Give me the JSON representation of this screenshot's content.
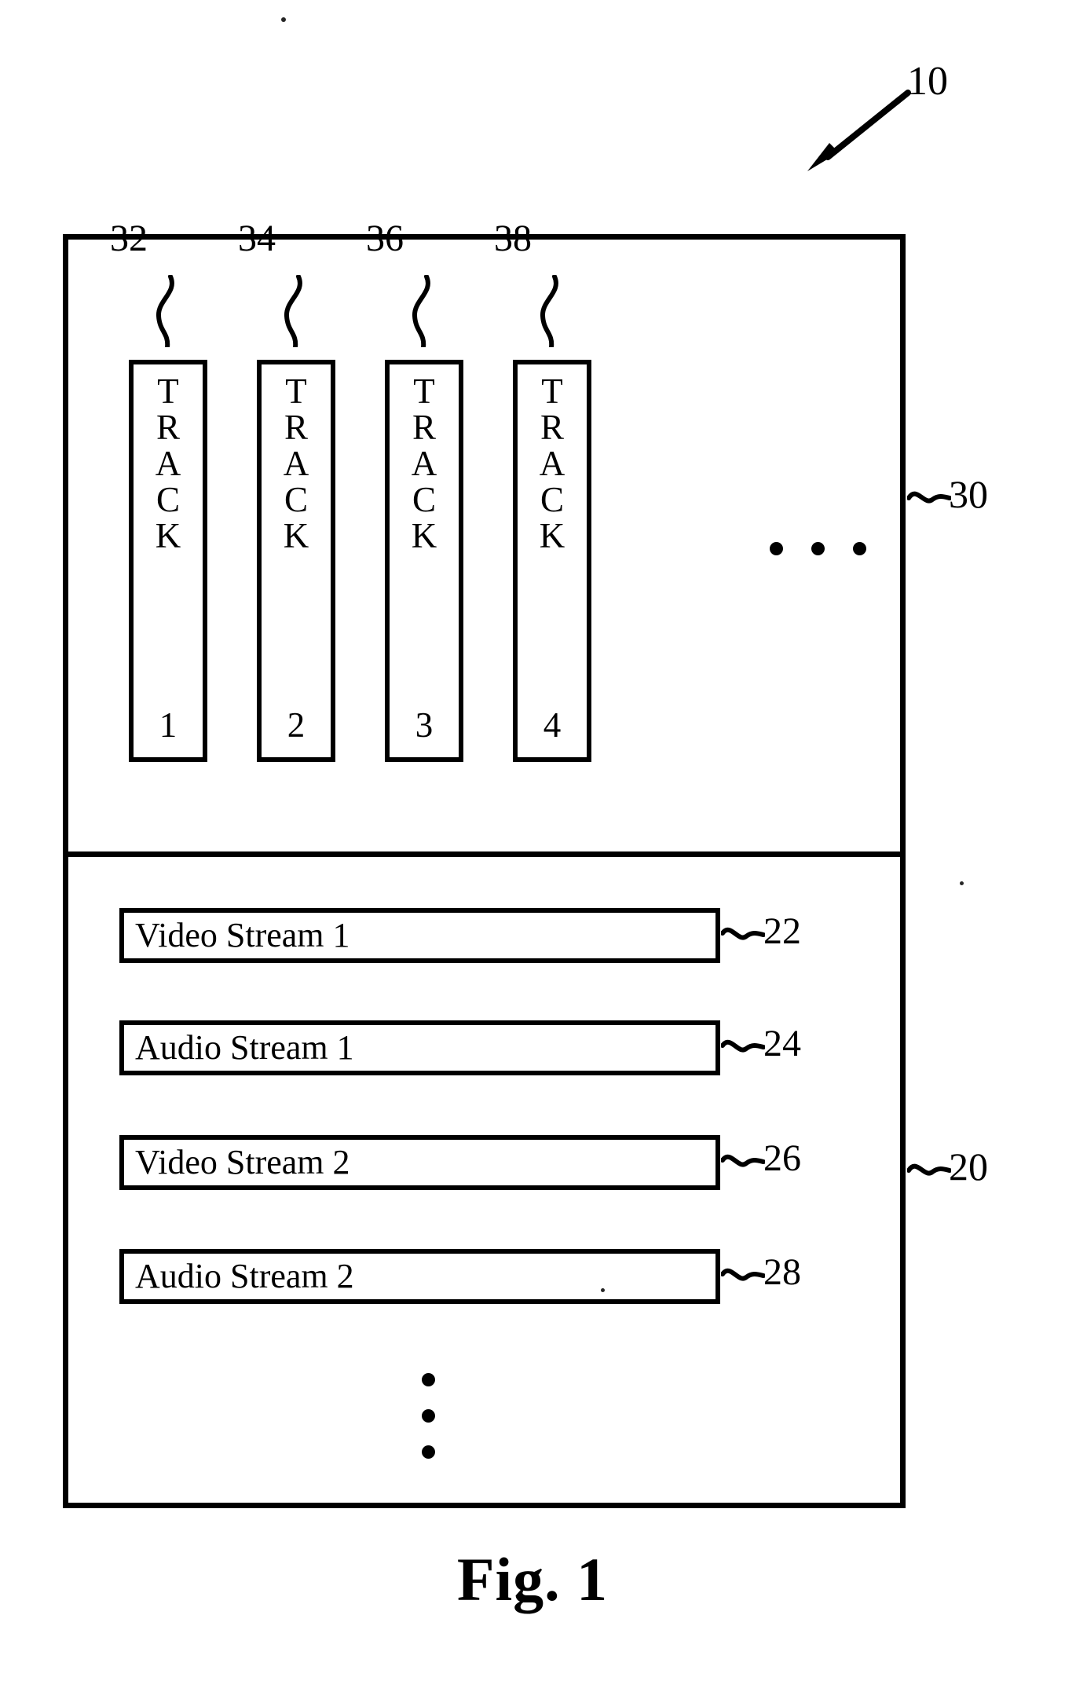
{
  "figure": {
    "caption": "Fig. 1",
    "overall_ref": "10"
  },
  "container": {
    "track_section": {
      "ref": "~30",
      "tracks": [
        {
          "ref": "32",
          "letters": [
            "T",
            "R",
            "A",
            "C",
            "K"
          ],
          "number": "1",
          "label": "TRACK 1"
        },
        {
          "ref": "34",
          "letters": [
            "T",
            "R",
            "A",
            "C",
            "K"
          ],
          "number": "2",
          "label": "TRACK 2"
        },
        {
          "ref": "36",
          "letters": [
            "T",
            "R",
            "A",
            "C",
            "K"
          ],
          "number": "3",
          "label": "TRACK 3"
        },
        {
          "ref": "38",
          "letters": [
            "T",
            "R",
            "A",
            "C",
            "K"
          ],
          "number": "4",
          "label": "TRACK 4"
        }
      ],
      "continuation": "• • •"
    },
    "stream_section": {
      "ref": "~20",
      "streams": [
        {
          "label": "Video Stream 1",
          "ref": "~22"
        },
        {
          "label": "Audio Stream 1",
          "ref": "~24"
        },
        {
          "label": "Video Stream 2",
          "ref": "~26"
        },
        {
          "label": "Audio Stream 2",
          "ref": "~28"
        }
      ],
      "continuation": "vertical-ellipsis"
    }
  }
}
